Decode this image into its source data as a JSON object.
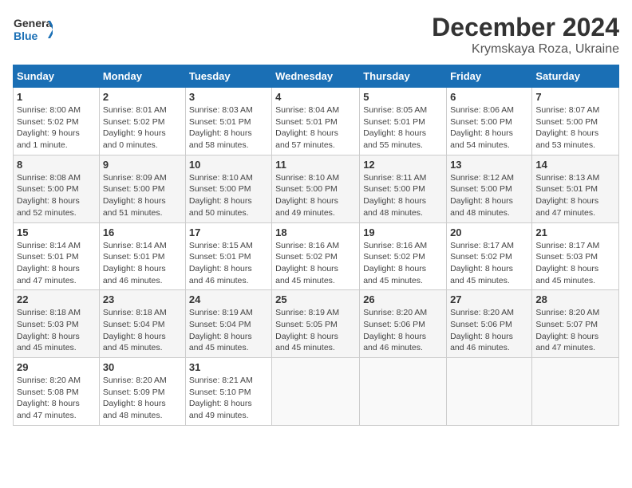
{
  "logo": {
    "line1": "General",
    "line2": "Blue"
  },
  "title": "December 2024",
  "subtitle": "Krymskaya Roza, Ukraine",
  "headers": [
    "Sunday",
    "Monday",
    "Tuesday",
    "Wednesday",
    "Thursday",
    "Friday",
    "Saturday"
  ],
  "weeks": [
    [
      {
        "day": "1",
        "detail": "Sunrise: 8:00 AM\nSunset: 5:02 PM\nDaylight: 9 hours\nand 1 minute."
      },
      {
        "day": "2",
        "detail": "Sunrise: 8:01 AM\nSunset: 5:02 PM\nDaylight: 9 hours\nand 0 minutes."
      },
      {
        "day": "3",
        "detail": "Sunrise: 8:03 AM\nSunset: 5:01 PM\nDaylight: 8 hours\nand 58 minutes."
      },
      {
        "day": "4",
        "detail": "Sunrise: 8:04 AM\nSunset: 5:01 PM\nDaylight: 8 hours\nand 57 minutes."
      },
      {
        "day": "5",
        "detail": "Sunrise: 8:05 AM\nSunset: 5:01 PM\nDaylight: 8 hours\nand 55 minutes."
      },
      {
        "day": "6",
        "detail": "Sunrise: 8:06 AM\nSunset: 5:00 PM\nDaylight: 8 hours\nand 54 minutes."
      },
      {
        "day": "7",
        "detail": "Sunrise: 8:07 AM\nSunset: 5:00 PM\nDaylight: 8 hours\nand 53 minutes."
      }
    ],
    [
      {
        "day": "8",
        "detail": "Sunrise: 8:08 AM\nSunset: 5:00 PM\nDaylight: 8 hours\nand 52 minutes."
      },
      {
        "day": "9",
        "detail": "Sunrise: 8:09 AM\nSunset: 5:00 PM\nDaylight: 8 hours\nand 51 minutes."
      },
      {
        "day": "10",
        "detail": "Sunrise: 8:10 AM\nSunset: 5:00 PM\nDaylight: 8 hours\nand 50 minutes."
      },
      {
        "day": "11",
        "detail": "Sunrise: 8:10 AM\nSunset: 5:00 PM\nDaylight: 8 hours\nand 49 minutes."
      },
      {
        "day": "12",
        "detail": "Sunrise: 8:11 AM\nSunset: 5:00 PM\nDaylight: 8 hours\nand 48 minutes."
      },
      {
        "day": "13",
        "detail": "Sunrise: 8:12 AM\nSunset: 5:00 PM\nDaylight: 8 hours\nand 48 minutes."
      },
      {
        "day": "14",
        "detail": "Sunrise: 8:13 AM\nSunset: 5:01 PM\nDaylight: 8 hours\nand 47 minutes."
      }
    ],
    [
      {
        "day": "15",
        "detail": "Sunrise: 8:14 AM\nSunset: 5:01 PM\nDaylight: 8 hours\nand 47 minutes."
      },
      {
        "day": "16",
        "detail": "Sunrise: 8:14 AM\nSunset: 5:01 PM\nDaylight: 8 hours\nand 46 minutes."
      },
      {
        "day": "17",
        "detail": "Sunrise: 8:15 AM\nSunset: 5:01 PM\nDaylight: 8 hours\nand 46 minutes."
      },
      {
        "day": "18",
        "detail": "Sunrise: 8:16 AM\nSunset: 5:02 PM\nDaylight: 8 hours\nand 45 minutes."
      },
      {
        "day": "19",
        "detail": "Sunrise: 8:16 AM\nSunset: 5:02 PM\nDaylight: 8 hours\nand 45 minutes."
      },
      {
        "day": "20",
        "detail": "Sunrise: 8:17 AM\nSunset: 5:02 PM\nDaylight: 8 hours\nand 45 minutes."
      },
      {
        "day": "21",
        "detail": "Sunrise: 8:17 AM\nSunset: 5:03 PM\nDaylight: 8 hours\nand 45 minutes."
      }
    ],
    [
      {
        "day": "22",
        "detail": "Sunrise: 8:18 AM\nSunset: 5:03 PM\nDaylight: 8 hours\nand 45 minutes."
      },
      {
        "day": "23",
        "detail": "Sunrise: 8:18 AM\nSunset: 5:04 PM\nDaylight: 8 hours\nand 45 minutes."
      },
      {
        "day": "24",
        "detail": "Sunrise: 8:19 AM\nSunset: 5:04 PM\nDaylight: 8 hours\nand 45 minutes."
      },
      {
        "day": "25",
        "detail": "Sunrise: 8:19 AM\nSunset: 5:05 PM\nDaylight: 8 hours\nand 45 minutes."
      },
      {
        "day": "26",
        "detail": "Sunrise: 8:20 AM\nSunset: 5:06 PM\nDaylight: 8 hours\nand 46 minutes."
      },
      {
        "day": "27",
        "detail": "Sunrise: 8:20 AM\nSunset: 5:06 PM\nDaylight: 8 hours\nand 46 minutes."
      },
      {
        "day": "28",
        "detail": "Sunrise: 8:20 AM\nSunset: 5:07 PM\nDaylight: 8 hours\nand 47 minutes."
      }
    ],
    [
      {
        "day": "29",
        "detail": "Sunrise: 8:20 AM\nSunset: 5:08 PM\nDaylight: 8 hours\nand 47 minutes."
      },
      {
        "day": "30",
        "detail": "Sunrise: 8:20 AM\nSunset: 5:09 PM\nDaylight: 8 hours\nand 48 minutes."
      },
      {
        "day": "31",
        "detail": "Sunrise: 8:21 AM\nSunset: 5:10 PM\nDaylight: 8 hours\nand 49 minutes."
      },
      null,
      null,
      null,
      null
    ]
  ]
}
